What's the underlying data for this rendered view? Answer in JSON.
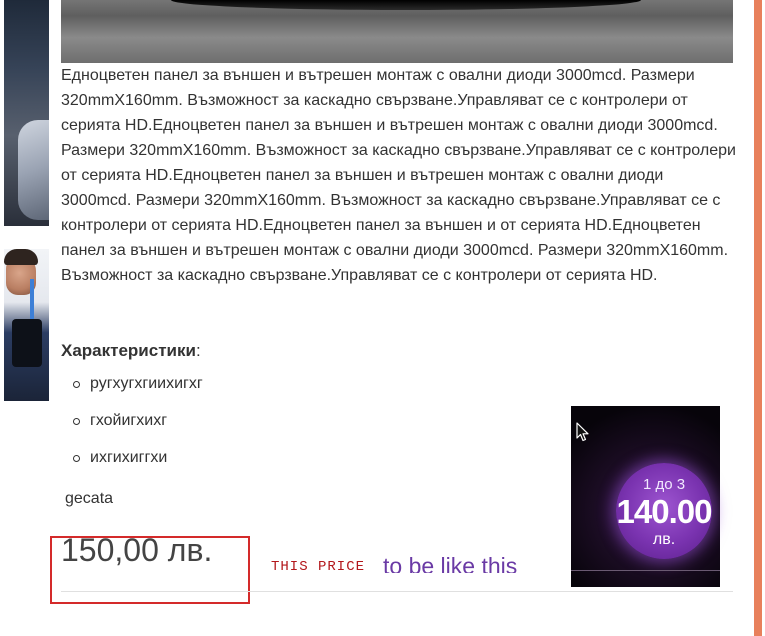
{
  "product": {
    "description": "Едноцветен панел за външен и вътрешен монтаж с овални диоди 3000mcd. Размери 320mmX160mm. Възможност за каскадно свързване.Управляват се с контролери от серията HD.Едноцветен панел за външен и вътрешен монтаж с овални диоди 3000mcd. Размери 320mmX160mm. Възможност за каскадно свързване.Управляват се с контролери от серията HD.Едноцветен панел за външен и вътрешен монтаж с овални диоди 3000mcd. Размери 320mmX160mm. Възможност за каскадно свързване.Управляват се с контролери от серията HD.Едноцветен панел за външен и от серията HD.Едноцветен панел за външен и вътрешен монтаж с овални диоди 3000mcd. Размери 320mmX160mm. Възможност за каскадно свързване.Управляват се с контролери от серията HD.",
    "specs_title": "Характеристики",
    "specs_colon": ":",
    "specs": [
      "ругхугхгиихигхг",
      "гхойигхихг",
      "ихгихиггхи"
    ],
    "extra_text": "gecata",
    "price": "150,00 лв."
  },
  "annotation": {
    "this_price": "THIS PRICE",
    "to_be_like": "to be like this"
  },
  "badge": {
    "of_label": "1 до 3",
    "amount": "140.00",
    "currency": "лв."
  },
  "colors": {
    "accent_right": "#e8805c",
    "highlight_box": "#d42a2a",
    "annotation_red": "#b3171b",
    "annotation_purple": "#6a3aa5",
    "badge_purple": "#7a33b0"
  },
  "icons": [
    "mouse-cursor-icon"
  ]
}
